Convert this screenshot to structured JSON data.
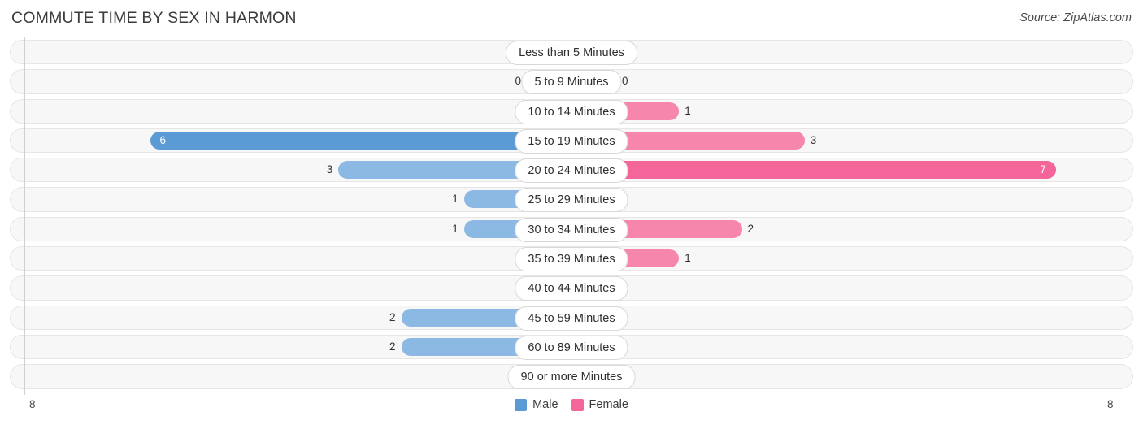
{
  "header": {
    "title": "COMMUTE TIME BY SEX IN HARMON",
    "source": "Source: ZipAtlas.com"
  },
  "footer": {
    "axis_left": "8",
    "axis_right": "8",
    "legend": [
      {
        "label": "Male",
        "color": "#5b9bd5"
      },
      {
        "label": "Female",
        "color": "#f4659a"
      }
    ]
  },
  "colors": {
    "male_strong": "#5b9bd5",
    "male_light": "#aecbef",
    "female_strong": "#f4659a",
    "female_light": "#f8a9c4",
    "track": "#f7f7f7",
    "track_border": "#e6e6e6",
    "axis": "#cfcfcf"
  },
  "chart_data": {
    "type": "bar",
    "orientation": "horizontal-diverging",
    "title": "COMMUTE TIME BY SEX IN HARMON",
    "xlabel": "",
    "ylabel": "",
    "xlim": [
      8,
      8
    ],
    "axis_max": 8,
    "grid": false,
    "legend_position": "bottom-center",
    "categories": [
      "Less than 5 Minutes",
      "5 to 9 Minutes",
      "10 to 14 Minutes",
      "15 to 19 Minutes",
      "20 to 24 Minutes",
      "25 to 29 Minutes",
      "30 to 34 Minutes",
      "35 to 39 Minutes",
      "40 to 44 Minutes",
      "45 to 59 Minutes",
      "60 to 89 Minutes",
      "90 or more Minutes"
    ],
    "series": [
      {
        "name": "Male",
        "values": [
          0,
          0,
          0,
          6,
          3,
          1,
          1,
          0,
          0,
          2,
          2,
          0
        ]
      },
      {
        "name": "Female",
        "values": [
          0,
          0,
          1,
          3,
          7,
          0,
          2,
          1,
          0,
          0,
          0,
          0
        ]
      }
    ],
    "value_labels": {
      "Male": [
        "0",
        "0",
        "0",
        "6",
        "3",
        "1",
        "1",
        "0",
        "0",
        "2",
        "2",
        "0"
      ],
      "Female": [
        "0",
        "0",
        "1",
        "3",
        "7",
        "0",
        "2",
        "1",
        "0",
        "0",
        "0",
        "0"
      ]
    }
  }
}
